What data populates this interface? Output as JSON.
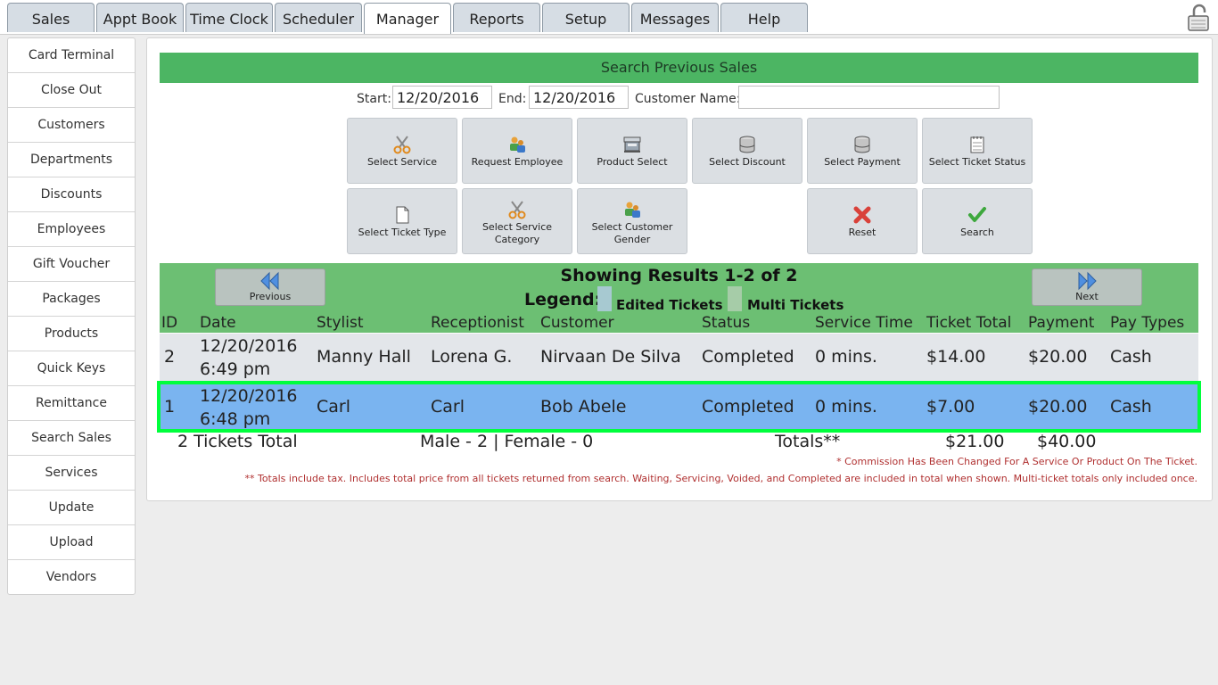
{
  "top_tabs": [
    "Sales",
    "Appt Book",
    "Time Clock",
    "Scheduler",
    "Manager",
    "Reports",
    "Setup",
    "Messages",
    "Help"
  ],
  "active_tab": "Manager",
  "sidebar": [
    "Card Terminal",
    "Close Out",
    "Customers",
    "Departments",
    "Discounts",
    "Employees",
    "Gift Voucher",
    "Packages",
    "Products",
    "Quick Keys",
    "Remittance",
    "Search Sales",
    "Services",
    "Update",
    "Upload",
    "Vendors"
  ],
  "search": {
    "title": "Search Previous Sales",
    "start_label": "Start:",
    "start_value": "12/20/2016",
    "end_label": "End:",
    "end_value": "12/20/2016",
    "customer_label": "Customer Name:",
    "customer_value": ""
  },
  "tool_buttons": {
    "select_service": "Select Service",
    "request_employee": "Request Employee",
    "product_select": "Product Select",
    "select_discount": "Select Discount",
    "select_payment": "Select Payment",
    "select_ticket_status": "Select Ticket Status",
    "select_ticket_type": "Select Ticket Type",
    "select_service_category_1": "Select Service",
    "select_service_category_2": "Category",
    "select_customer_gender_1": "Select Customer",
    "select_customer_gender_2": "Gender",
    "reset": "Reset",
    "search": "Search"
  },
  "results": {
    "showing": "Showing Results 1-2 of 2",
    "previous": "Previous",
    "next": "Next",
    "legend_label": "Legend:",
    "legend_edited": "Edited Tickets",
    "legend_multi": "Multi Tickets",
    "columns": [
      "ID",
      "Date",
      "Stylist",
      "Receptionist",
      "Customer",
      "Status",
      "Service Time",
      "Ticket Total",
      "Payment",
      "Pay Types"
    ],
    "rows": [
      {
        "id": "2",
        "date1": "12/20/2016",
        "date2": "6:49 pm",
        "stylist": "Manny Hall",
        "receptionist": "Lorena G.",
        "customer": "Nirvaan De Silva",
        "status": "Completed",
        "service_time": "0 mins.",
        "ticket_total": "$14.00",
        "payment": "$20.00",
        "pay_types": "Cash"
      },
      {
        "id": "1",
        "date1": "12/20/2016",
        "date2": "6:48 pm",
        "stylist": "Carl",
        "receptionist": "Carl",
        "customer": "Bob Abele",
        "status": "Completed",
        "service_time": "0 mins.",
        "ticket_total": "$7.00",
        "payment": "$20.00",
        "pay_types": "Cash"
      }
    ]
  },
  "totals": {
    "tickets": "2 Tickets Total",
    "gender": "Male - 2 | Female - 0",
    "label": "Totals**",
    "ticket_total": "$21.00",
    "payment_total": "$40.00"
  },
  "notes": {
    "commission": "* Commission Has Been Changed For A Service Or Product On The Ticket.",
    "totals": "** Totals include tax. Includes total price from all tickets returned from search. Waiting, Servicing, Voided, and Completed are included in total when shown. Multi-ticket totals only included once."
  },
  "colors": {
    "header_green": "#4cb563",
    "results_green": "#6cbf73",
    "row_normal": "#e3e6ea",
    "row_selected": "#7ab4f0",
    "selection_outline": "#00ff3c"
  }
}
